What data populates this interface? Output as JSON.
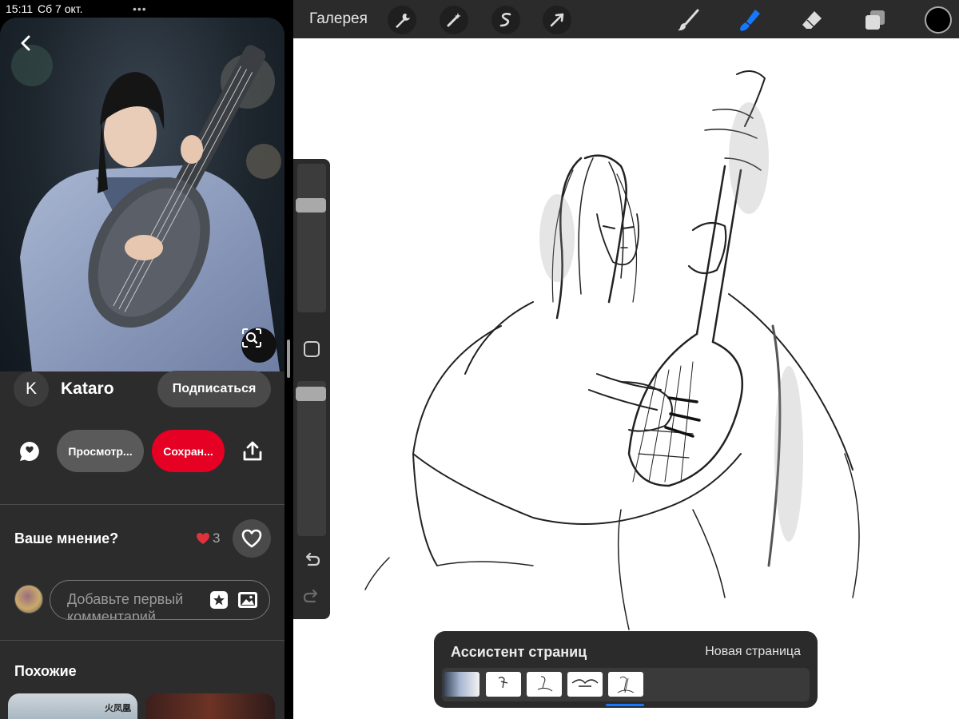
{
  "status_bar": {
    "time": "15:11",
    "date": "Сб 7 окт.",
    "dots": "•••"
  },
  "pin": {
    "author": {
      "initial": "K",
      "name": "Kataro"
    },
    "follow_label": "Подписаться",
    "view_label": "Просмотр...",
    "save_label": "Сохран...",
    "opinion_label": "Ваше мнение?",
    "reaction_count": "3",
    "comment_placeholder": "Добавьте первый комментарий",
    "similar_label": "Похожие",
    "similar_thumb_logo": "火凤凰"
  },
  "procreate": {
    "gallery_label": "Галерея",
    "tools_left": [
      "wrench-icon",
      "magic-wand-icon",
      "selection-icon",
      "transform-arrow-icon"
    ],
    "tools_right": [
      "brush-icon",
      "smudge-icon",
      "eraser-icon",
      "layers-icon"
    ],
    "active_tool": "smudge-icon",
    "accent_color": "#1677ff",
    "current_color": "#000000",
    "page_assistant": {
      "title": "Ассистент страниц",
      "new_page_label": "Новая страница",
      "page_count": 5,
      "selected_page": 1
    }
  },
  "colors": {
    "save": "#e60023",
    "pane": "#2c2c2c",
    "toolbar": "#2b2b2b"
  }
}
